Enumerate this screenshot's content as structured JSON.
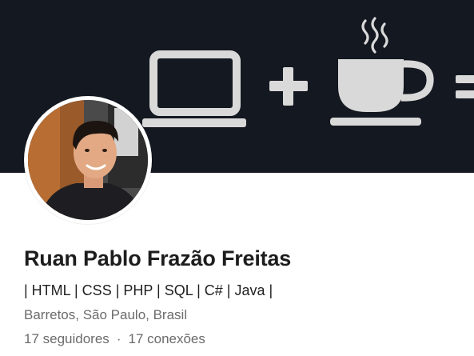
{
  "profile": {
    "name": "Ruan Pablo Frazão Freitas",
    "headline": "| HTML | CSS | PHP | SQL | C# | Java |",
    "location": "Barretos, São Paulo, Brasil",
    "followers_label": "17 seguidores",
    "separator": "·",
    "connections_label": "17 conexões"
  },
  "banner": {
    "background_color": "#141820",
    "icons": [
      "laptop-icon",
      "plus-icon",
      "coffee-cup-icon",
      "equals-icon"
    ],
    "icon_color": "#d9d9d9"
  }
}
